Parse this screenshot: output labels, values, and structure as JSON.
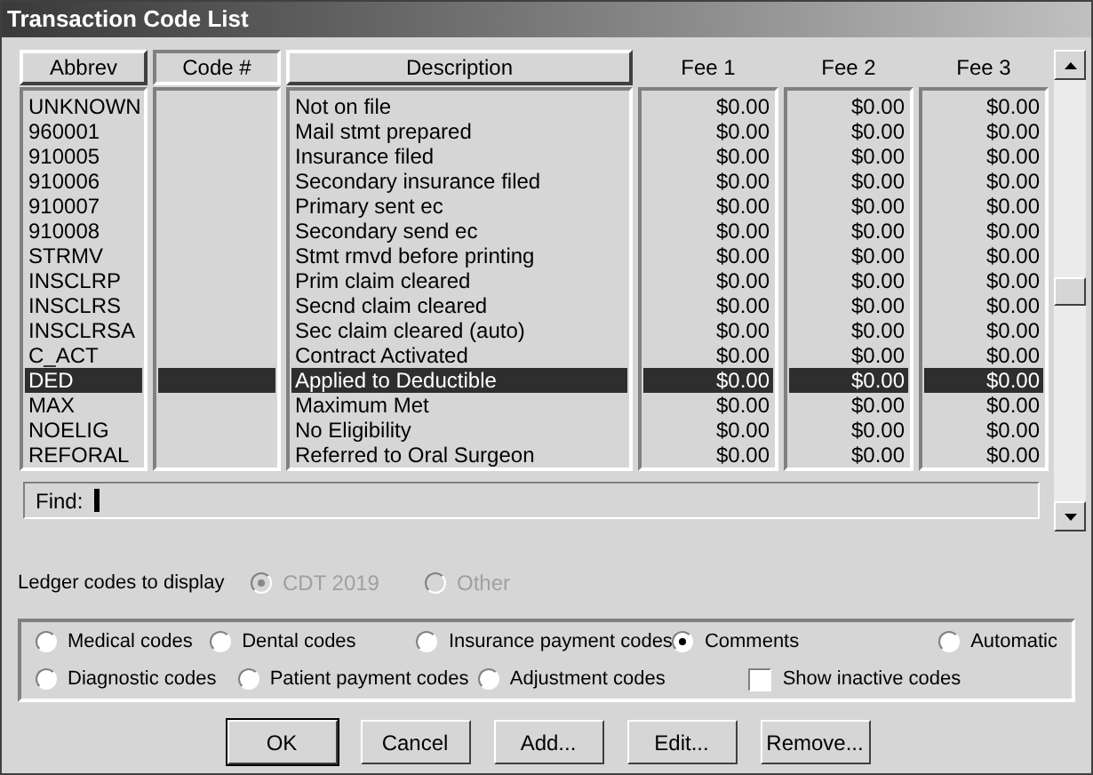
{
  "window": {
    "title": "Transaction Code List"
  },
  "columns": [
    {
      "label": "Abbrev",
      "kind": "button",
      "selected": false
    },
    {
      "label": "Code #",
      "kind": "button",
      "selected": true
    },
    {
      "label": "Description",
      "kind": "button",
      "selected": false
    },
    {
      "label": "Fee 1",
      "kind": "label"
    },
    {
      "label": "Fee 2",
      "kind": "label"
    },
    {
      "label": "Fee 3",
      "kind": "label"
    }
  ],
  "rows": [
    {
      "abbrev": "UNKNOWN",
      "description": "Not on file",
      "fees": [
        "$0.00",
        "$0.00",
        "$0.00"
      ],
      "selected": false
    },
    {
      "abbrev": "960001",
      "description": "Mail stmt prepared",
      "fees": [
        "$0.00",
        "$0.00",
        "$0.00"
      ],
      "selected": false
    },
    {
      "abbrev": "910005",
      "description": "Insurance filed",
      "fees": [
        "$0.00",
        "$0.00",
        "$0.00"
      ],
      "selected": false
    },
    {
      "abbrev": "910006",
      "description": "Secondary insurance filed",
      "fees": [
        "$0.00",
        "$0.00",
        "$0.00"
      ],
      "selected": false
    },
    {
      "abbrev": "910007",
      "description": "Primary sent ec",
      "fees": [
        "$0.00",
        "$0.00",
        "$0.00"
      ],
      "selected": false
    },
    {
      "abbrev": "910008",
      "description": "Secondary send ec",
      "fees": [
        "$0.00",
        "$0.00",
        "$0.00"
      ],
      "selected": false
    },
    {
      "abbrev": "STRMV",
      "description": "Stmt rmvd before printing",
      "fees": [
        "$0.00",
        "$0.00",
        "$0.00"
      ],
      "selected": false
    },
    {
      "abbrev": "INSCLRP",
      "description": "Prim claim cleared",
      "fees": [
        "$0.00",
        "$0.00",
        "$0.00"
      ],
      "selected": false
    },
    {
      "abbrev": "INSCLRS",
      "description": "Secnd claim cleared",
      "fees": [
        "$0.00",
        "$0.00",
        "$0.00"
      ],
      "selected": false
    },
    {
      "abbrev": "INSCLRSA",
      "description": "Sec claim cleared (auto)",
      "fees": [
        "$0.00",
        "$0.00",
        "$0.00"
      ],
      "selected": false
    },
    {
      "abbrev": "C_ACT",
      "description": "Contract Activated",
      "fees": [
        "$0.00",
        "$0.00",
        "$0.00"
      ],
      "selected": false
    },
    {
      "abbrev": "DED",
      "description": "Applied to Deductible",
      "fees": [
        "$0.00",
        "$0.00",
        "$0.00"
      ],
      "selected": true
    },
    {
      "abbrev": "MAX",
      "description": "Maximum Met",
      "fees": [
        "$0.00",
        "$0.00",
        "$0.00"
      ],
      "selected": false
    },
    {
      "abbrev": "NOELIG",
      "description": "No Eligibility",
      "fees": [
        "$0.00",
        "$0.00",
        "$0.00"
      ],
      "selected": false
    },
    {
      "abbrev": "REFORAL",
      "description": "Referred to Oral Surgeon",
      "fees": [
        "$0.00",
        "$0.00",
        "$0.00"
      ],
      "selected": false
    }
  ],
  "find": {
    "label": "Find:"
  },
  "ledger": {
    "label": "Ledger codes to display",
    "options": [
      {
        "label": "CDT 2019",
        "selected": true,
        "disabled": true
      },
      {
        "label": "Other",
        "selected": false,
        "disabled": true
      }
    ]
  },
  "filters": [
    [
      {
        "kind": "radio",
        "label": "Medical codes",
        "checked": false
      },
      {
        "kind": "radio",
        "label": "Dental codes",
        "checked": false
      },
      {
        "kind": "radio",
        "label": "Insurance payment codes",
        "checked": false
      },
      {
        "kind": "radio",
        "label": "Comments",
        "checked": true
      },
      {
        "kind": "radio",
        "label": "Automatic",
        "checked": false
      }
    ],
    [
      {
        "kind": "radio",
        "label": "Diagnostic codes",
        "checked": false
      },
      {
        "kind": "radio",
        "label": "Patient payment codes",
        "checked": false
      },
      {
        "kind": "radio",
        "label": "Adjustment codes",
        "checked": false
      },
      {
        "kind": "checkbox",
        "label": "Show inactive codes",
        "checked": false
      }
    ]
  ],
  "buttons": [
    {
      "label": "OK",
      "default": true
    },
    {
      "label": "Cancel",
      "default": false
    },
    {
      "label": "Add...",
      "default": false
    },
    {
      "label": "Edit...",
      "default": false
    },
    {
      "label": "Remove...",
      "default": false
    }
  ]
}
